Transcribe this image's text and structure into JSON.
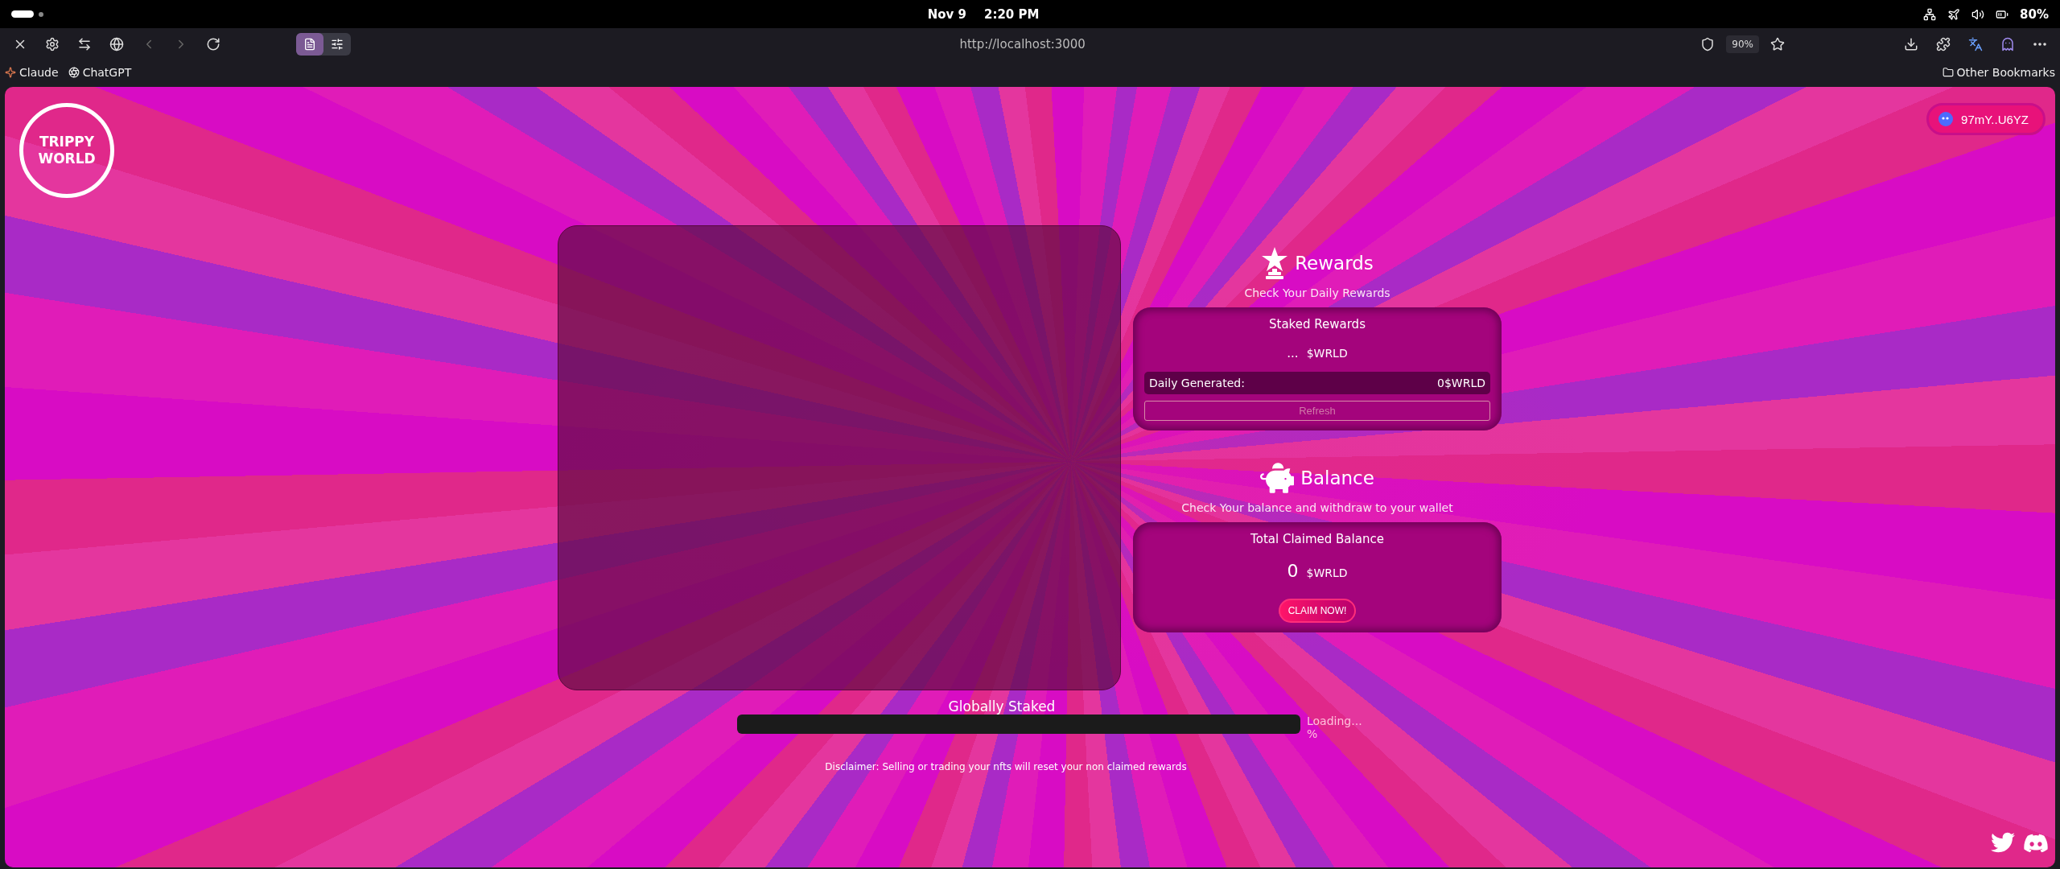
{
  "system_bar": {
    "date": "Nov 9",
    "time": "2:20 PM",
    "battery": "80%"
  },
  "browser": {
    "url": "http://localhost:3000",
    "zoom": "90%",
    "view_toggle": [
      {
        "kind": "page",
        "selected": true
      },
      {
        "kind": "settings",
        "selected": false
      }
    ]
  },
  "bookmarks": [
    {
      "label": "Claude",
      "kind": "claude"
    },
    {
      "label": "ChatGPT",
      "kind": "chatgpt"
    }
  ],
  "other_bookmarks": "Other Bookmarks",
  "page": {
    "logo": "TRIPPY WORLD",
    "wallet": "97mY..U6YZ",
    "rewards": {
      "title": "Rewards",
      "subtitle": "Check Your Daily Rewards",
      "card_title": "Staked Rewards",
      "amount": "...",
      "unit": "$WRLD",
      "daily_label": "Daily Generated:",
      "daily_value": "0$WRLD",
      "refresh": "Refresh",
      "refresh_disabled": true
    },
    "balance": {
      "title": "Balance",
      "subtitle": "Check Your balance and withdraw to your wallet",
      "card_title": "Total Claimed Balance",
      "amount": "0",
      "unit": "$WRLD",
      "claim": "CLAIM NOW!"
    },
    "global": {
      "title": "Globally Staked",
      "level": 0,
      "status": "Loading...",
      "percent": "%"
    },
    "disclaimer": "Disclaimer: Selling or trading your nfts will reset your non claimed rewards"
  }
}
